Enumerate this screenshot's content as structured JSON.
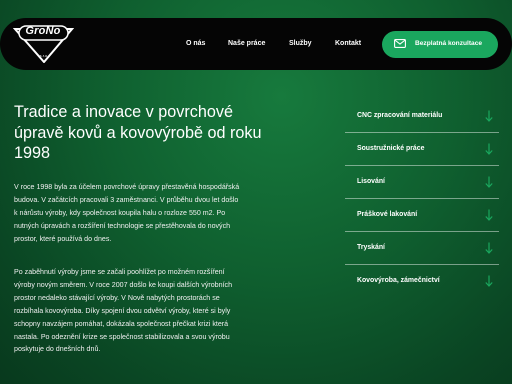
{
  "brand": {
    "logo_text": "GroNo",
    "logo_subtext": "s.r.o."
  },
  "nav": {
    "items": [
      "O nás",
      "Naše práce",
      "Služby",
      "Kontakt"
    ],
    "cta_label": "Bezplatná konzultace"
  },
  "main": {
    "heading": "Tradice a inovace v povrchové úpravě kovů a kovovýrobě od roku 1998",
    "paragraphs": [
      "V roce 1998 byla za účelem povrchové úpravy přestavěná hospodářská budova. V začátcích pracovali 3 zaměstnanci. V průběhu dvou let došlo k nárůstu výroby, kdy společnost koupila halu o rozloze 550 m2. Po nutných úpravách a rozšíření technologie se přestěhovala do nových prostor, které používá do dnes.",
      "Po zaběhnutí výroby jsme se začali poohlížet po možném rozšíření výroby novým směrem. V roce 2007 došlo ke koupi dalších výrobních prostor nedaleko stávající výroby. V Nově nabytých prostorách se rozbíhala kovovýroba. Díky spojení dvou odvětví výroby, které si byly schopny navzájem pomáhat, dokázala společnost přečkat krizi která nastala. Po odeznění krize se společnost stabilizovala a svou výrobu poskytuje do dnešních dnů."
    ]
  },
  "services": {
    "items": [
      "CNC zpracování materiálu",
      "Soustružnické práce",
      "Lisování",
      "Práškové lakování",
      "Tryskání",
      "Kovovýroba, zámečnictví"
    ]
  },
  "colors": {
    "accent": "#1aa75e",
    "bar": "#050505",
    "background": "#0f5f2f"
  }
}
